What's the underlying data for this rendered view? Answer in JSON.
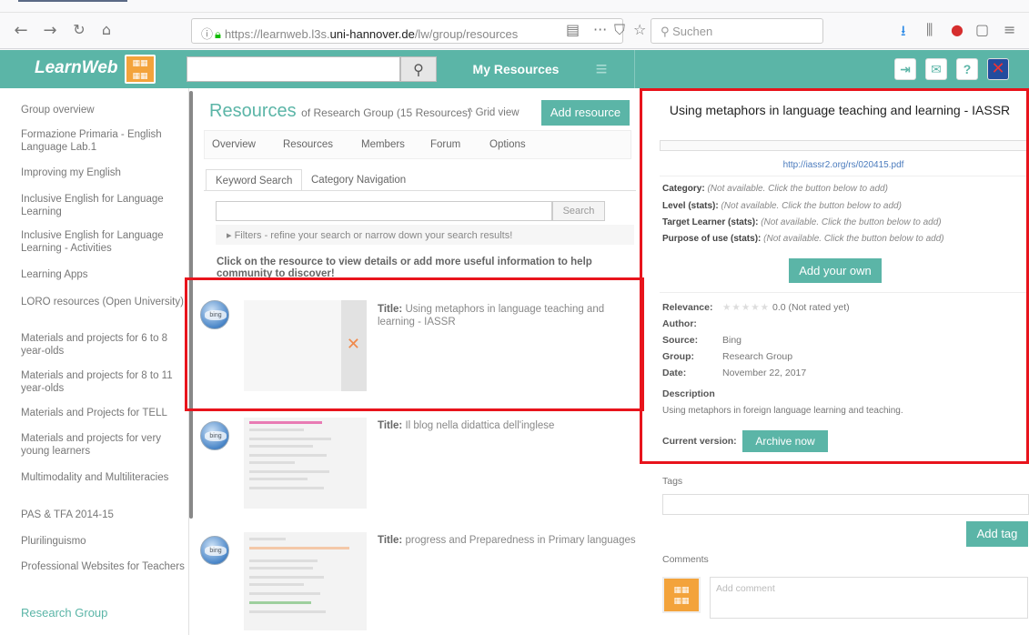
{
  "browser": {
    "url_prefix": "https://learnweb.l3s.",
    "url_host": "uni-hannover.de",
    "url_path": "/lw/group/resources",
    "search_placeholder": "Suchen"
  },
  "header": {
    "logo": "LearnWeb",
    "my_resources": "My Resources",
    "accent_color": "#5bb5a7"
  },
  "sidebar": {
    "items": [
      "Group overview",
      "Formazione Primaria - English Language Lab.1",
      "Improving my English",
      "Inclusive English for Language Learning",
      "Inclusive English for Language Learning - Activities",
      "Learning Apps",
      "LORO resources (Open University)",
      "Materials and projects for 6 to 8 year-olds",
      "Materials and projects for 8 to 11 year-olds",
      "Materials and Projects for TELL",
      "Materials and projects for very young learners",
      "Multimodality and Multiliteracies",
      "PAS & TFA 2014-15",
      "Plurilinguismo",
      "Professional Websites for Teachers"
    ],
    "current_group": "Research Group"
  },
  "resources": {
    "title": "Resources",
    "subtitle": "of Research Group (15 Resources)",
    "grid_view": "^ Grid view",
    "add_resource": "Add resource",
    "tabs": [
      "Overview",
      "Resources",
      "Members",
      "Forum",
      "Options"
    ],
    "search_tabs": [
      "Keyword Search",
      "Category Navigation"
    ],
    "search_button": "Search",
    "filters": "▸ Filters - refine your search or narrow down your search results!",
    "click_hint": "Click on the resource to view details or add more useful information to help community to discover!",
    "title_label": "Title:",
    "items": [
      {
        "title": "Using metaphors in language teaching and learning - IASSR"
      },
      {
        "title": "Il blog nella didattica dell'inglese"
      },
      {
        "title": "progress and Preparedness in Primary languages"
      }
    ]
  },
  "detail": {
    "title": "Using metaphors in language teaching and learning - IASSR",
    "link": "http://iassr2.org/rs/020415.pdf",
    "props": [
      {
        "label": "Category:",
        "value": "(Not available. Click the button below to add)"
      },
      {
        "label": "Level (stats):",
        "value": "(Not available. Click the button below to add)"
      },
      {
        "label": "Target Learner (stats):",
        "value": "(Not available. Click the button below to add)"
      },
      {
        "label": "Purpose of use (stats):",
        "value": "(Not available. Click the button below to add)"
      }
    ],
    "add_own": "Add your own",
    "relevance_label": "Relevance:",
    "relevance_value": "0.0 (Not rated yet)",
    "rating": 0,
    "author_label": "Author:",
    "source_label": "Source:",
    "source": "Bing",
    "group_label": "Group:",
    "group": "Research Group",
    "date_label": "Date:",
    "date": "November 22, 2017",
    "description_label": "Description",
    "description": "Using metaphors in foreign language learning and teaching.",
    "current_version_label": "Current version:",
    "archive_now": "Archive now",
    "tags_label": "Tags",
    "add_tag": "Add tag",
    "comments_label": "Comments",
    "comment_placeholder": "Add comment"
  }
}
